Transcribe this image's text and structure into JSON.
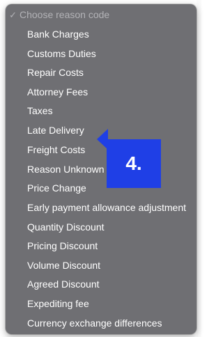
{
  "dropdown": {
    "selected_placeholder": "Choose reason code",
    "check_icon": "✓",
    "options": [
      "Bank Charges",
      "Customs Duties",
      "Repair Costs",
      "Attorney Fees",
      "Taxes",
      "Late Delivery",
      "Freight Costs",
      "Reason Unknown",
      "Price Change",
      "Early payment allowance adjustment",
      "Quantity Discount",
      "Pricing Discount",
      "Volume Discount",
      "Agreed Discount",
      "Expediting fee",
      "Currency exchange differences"
    ]
  },
  "annotation": {
    "step_label": "4.",
    "color": "#1f3fe6"
  },
  "colors": {
    "menu_background": "#6f6f73",
    "menu_text": "#ffffff",
    "disabled_text": "#b3b3b7"
  }
}
